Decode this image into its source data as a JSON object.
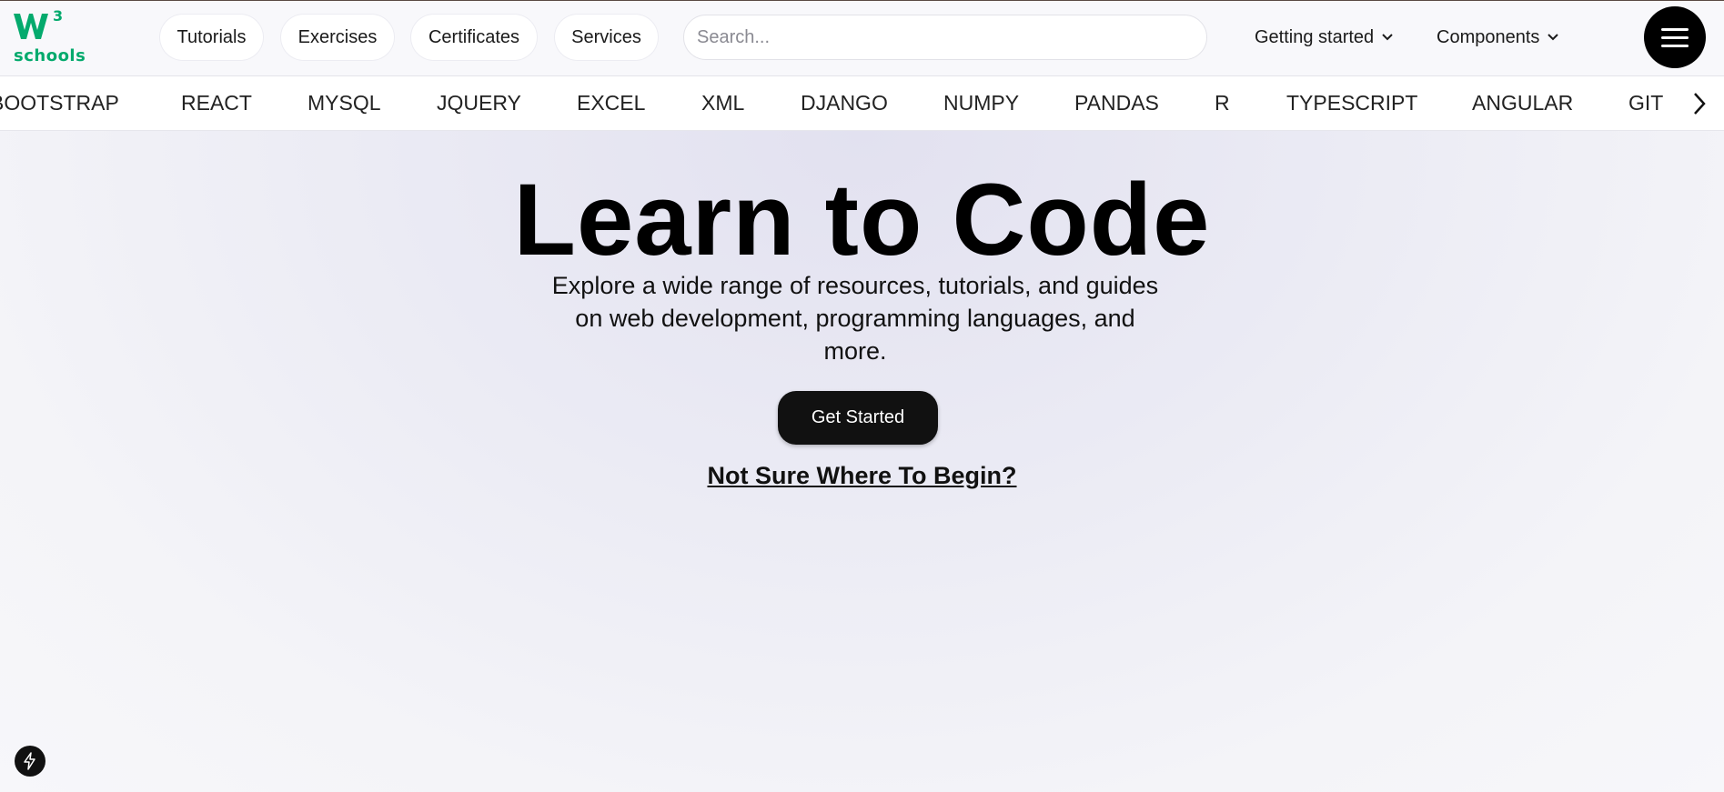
{
  "header": {
    "logo_text": "schools",
    "logo_mark": "W3",
    "nav_pills": [
      {
        "label": "Tutorials"
      },
      {
        "label": "Exercises"
      },
      {
        "label": "Certificates"
      },
      {
        "label": "Services"
      }
    ],
    "search": {
      "placeholder": "Search...",
      "value": ""
    },
    "dropdowns": [
      {
        "label": "Getting started",
        "icon": "chevron-down-icon"
      },
      {
        "label": "Components",
        "icon": "chevron-down-icon"
      }
    ],
    "menu_icon": "hamburger-menu-icon"
  },
  "subnav": {
    "items": [
      "BOOTSTRAP",
      "REACT",
      "MYSQL",
      "JQUERY",
      "EXCEL",
      "XML",
      "DJANGO",
      "NUMPY",
      "PANDAS",
      "R",
      "TYPESCRIPT",
      "ANGULAR",
      "GIT"
    ],
    "next_icon": "chevron-right-icon"
  },
  "hero": {
    "title": "Learn to Code",
    "subtitle": "Explore a wide range of resources, tutorials, and guides on web development, programming languages, and more.",
    "cta_label": "Get Started",
    "link_label": "Not Sure Where To Begin?"
  },
  "floating": {
    "icon": "lightning-bolt-icon"
  },
  "colors": {
    "brand_green": "#04aa6d",
    "dark": "#111111",
    "hero_bg": "#ebebf4"
  }
}
